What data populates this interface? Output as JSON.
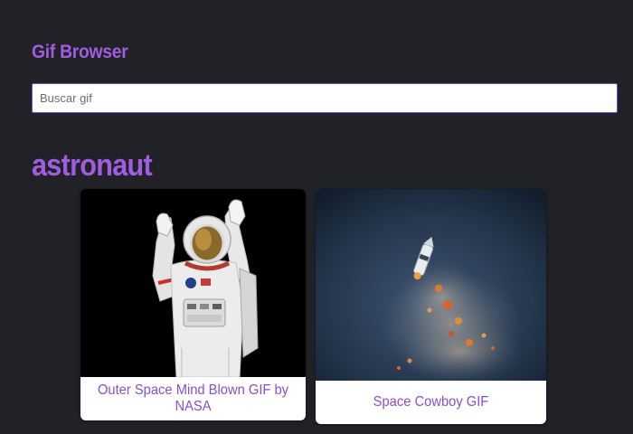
{
  "header": {
    "title": "Gif Browser"
  },
  "search": {
    "placeholder": "Buscar gif",
    "value": ""
  },
  "category": {
    "title": "astronaut"
  },
  "gifs": [
    {
      "title": "Outer Space Mind Blown GIF by NASA",
      "image": "astronaut-image"
    },
    {
      "title": "Space Cowboy GIF",
      "image": "rocket-image"
    }
  ],
  "colors": {
    "background": "#202227",
    "accent": "#a15de0",
    "card_background": "#ffffff",
    "caption_text": "#8a4fd0"
  }
}
